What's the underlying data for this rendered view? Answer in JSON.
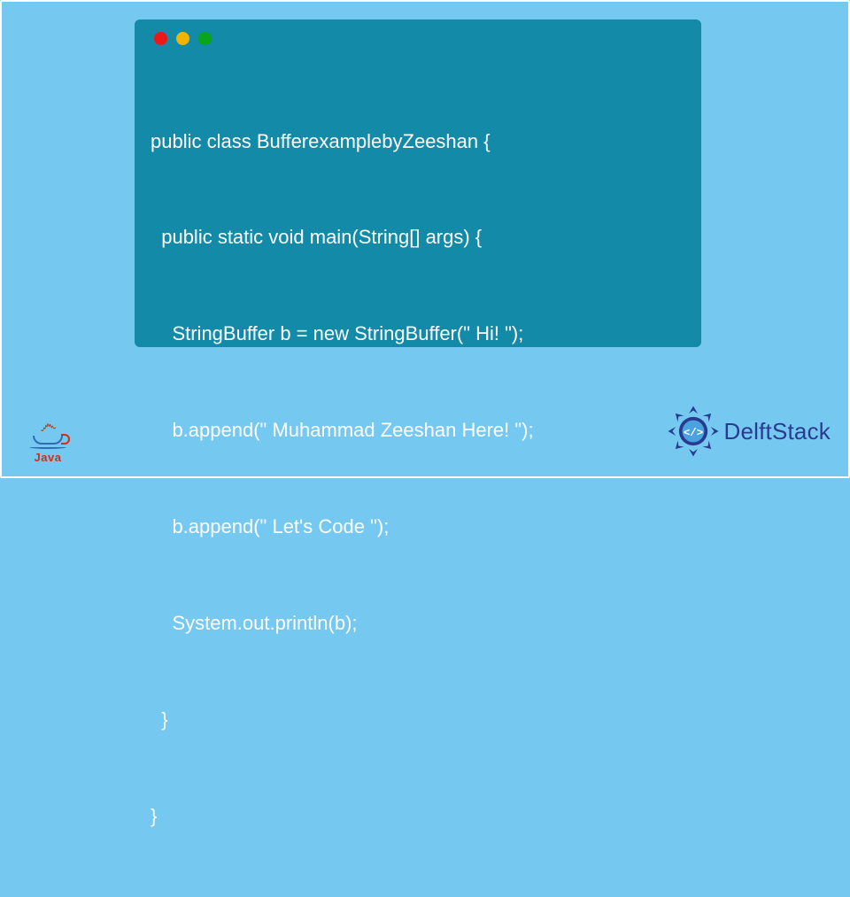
{
  "code": {
    "lines": [
      "public class BufferexamplebyZeeshan {",
      "  public static void main(String[] args) {",
      "    StringBuffer b = new StringBuffer(\" Hi! \");",
      "    b.append(\" Muhammad Zeeshan Here! \");",
      "    b.append(\" Let's Code \");",
      "    System.out.println(b);",
      "  }",
      "}"
    ]
  },
  "java_logo": {
    "label": "Java"
  },
  "delft_logo": {
    "text": "DelftStack"
  },
  "colors": {
    "page_bg": "#75c8f0",
    "window_bg": "#138aa8",
    "code_text": "#ffffff",
    "dot_red": "#ec1818",
    "dot_yellow": "#f1b400",
    "dot_green": "#09a51b",
    "java_red": "#d42e12",
    "java_blue": "#2f6db3",
    "delft_blue": "#2a3b8f"
  }
}
